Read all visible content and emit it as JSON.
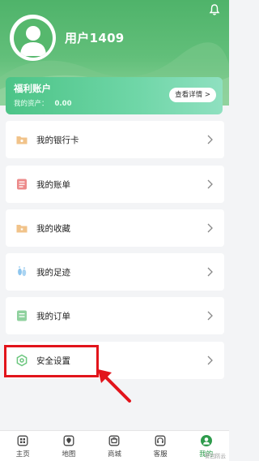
{
  "header": {
    "username": "用户1409",
    "bell_icon": "bell-icon",
    "avatar_icon": "user-avatar-icon"
  },
  "welfare": {
    "title": "福利账户",
    "assets_label": "我的资产：",
    "assets_value": "0.00",
    "details_button": "查看详情 >"
  },
  "menu": {
    "items": [
      {
        "label": "我的银行卡",
        "icon": "bank-card-icon",
        "color": "#f1c38a"
      },
      {
        "label": "我的账单",
        "icon": "bill-icon",
        "color": "#ec8a8a"
      },
      {
        "label": "我的收藏",
        "icon": "favorite-folder-icon",
        "color": "#f1c38a"
      },
      {
        "label": "我的足迹",
        "icon": "footprint-icon",
        "color": "#8ec6ee"
      },
      {
        "label": "我的订单",
        "icon": "order-icon",
        "color": "#8fd19e"
      },
      {
        "label": "安全设置",
        "icon": "security-settings-icon",
        "color": "#6cc77f"
      }
    ]
  },
  "tabs": [
    {
      "label": "主页",
      "icon": "home-icon",
      "active": false
    },
    {
      "label": "地图",
      "icon": "map-icon",
      "active": false
    },
    {
      "label": "商城",
      "icon": "mall-icon",
      "active": false
    },
    {
      "label": "客服",
      "icon": "customer-service-icon",
      "active": false
    },
    {
      "label": "我的",
      "icon": "profile-icon",
      "active": true
    }
  ],
  "colors": {
    "brand_green": "#4fb36a",
    "active_tab": "#2e9b4c",
    "highlight_red": "#e2141b"
  },
  "watermark": "警回防云"
}
